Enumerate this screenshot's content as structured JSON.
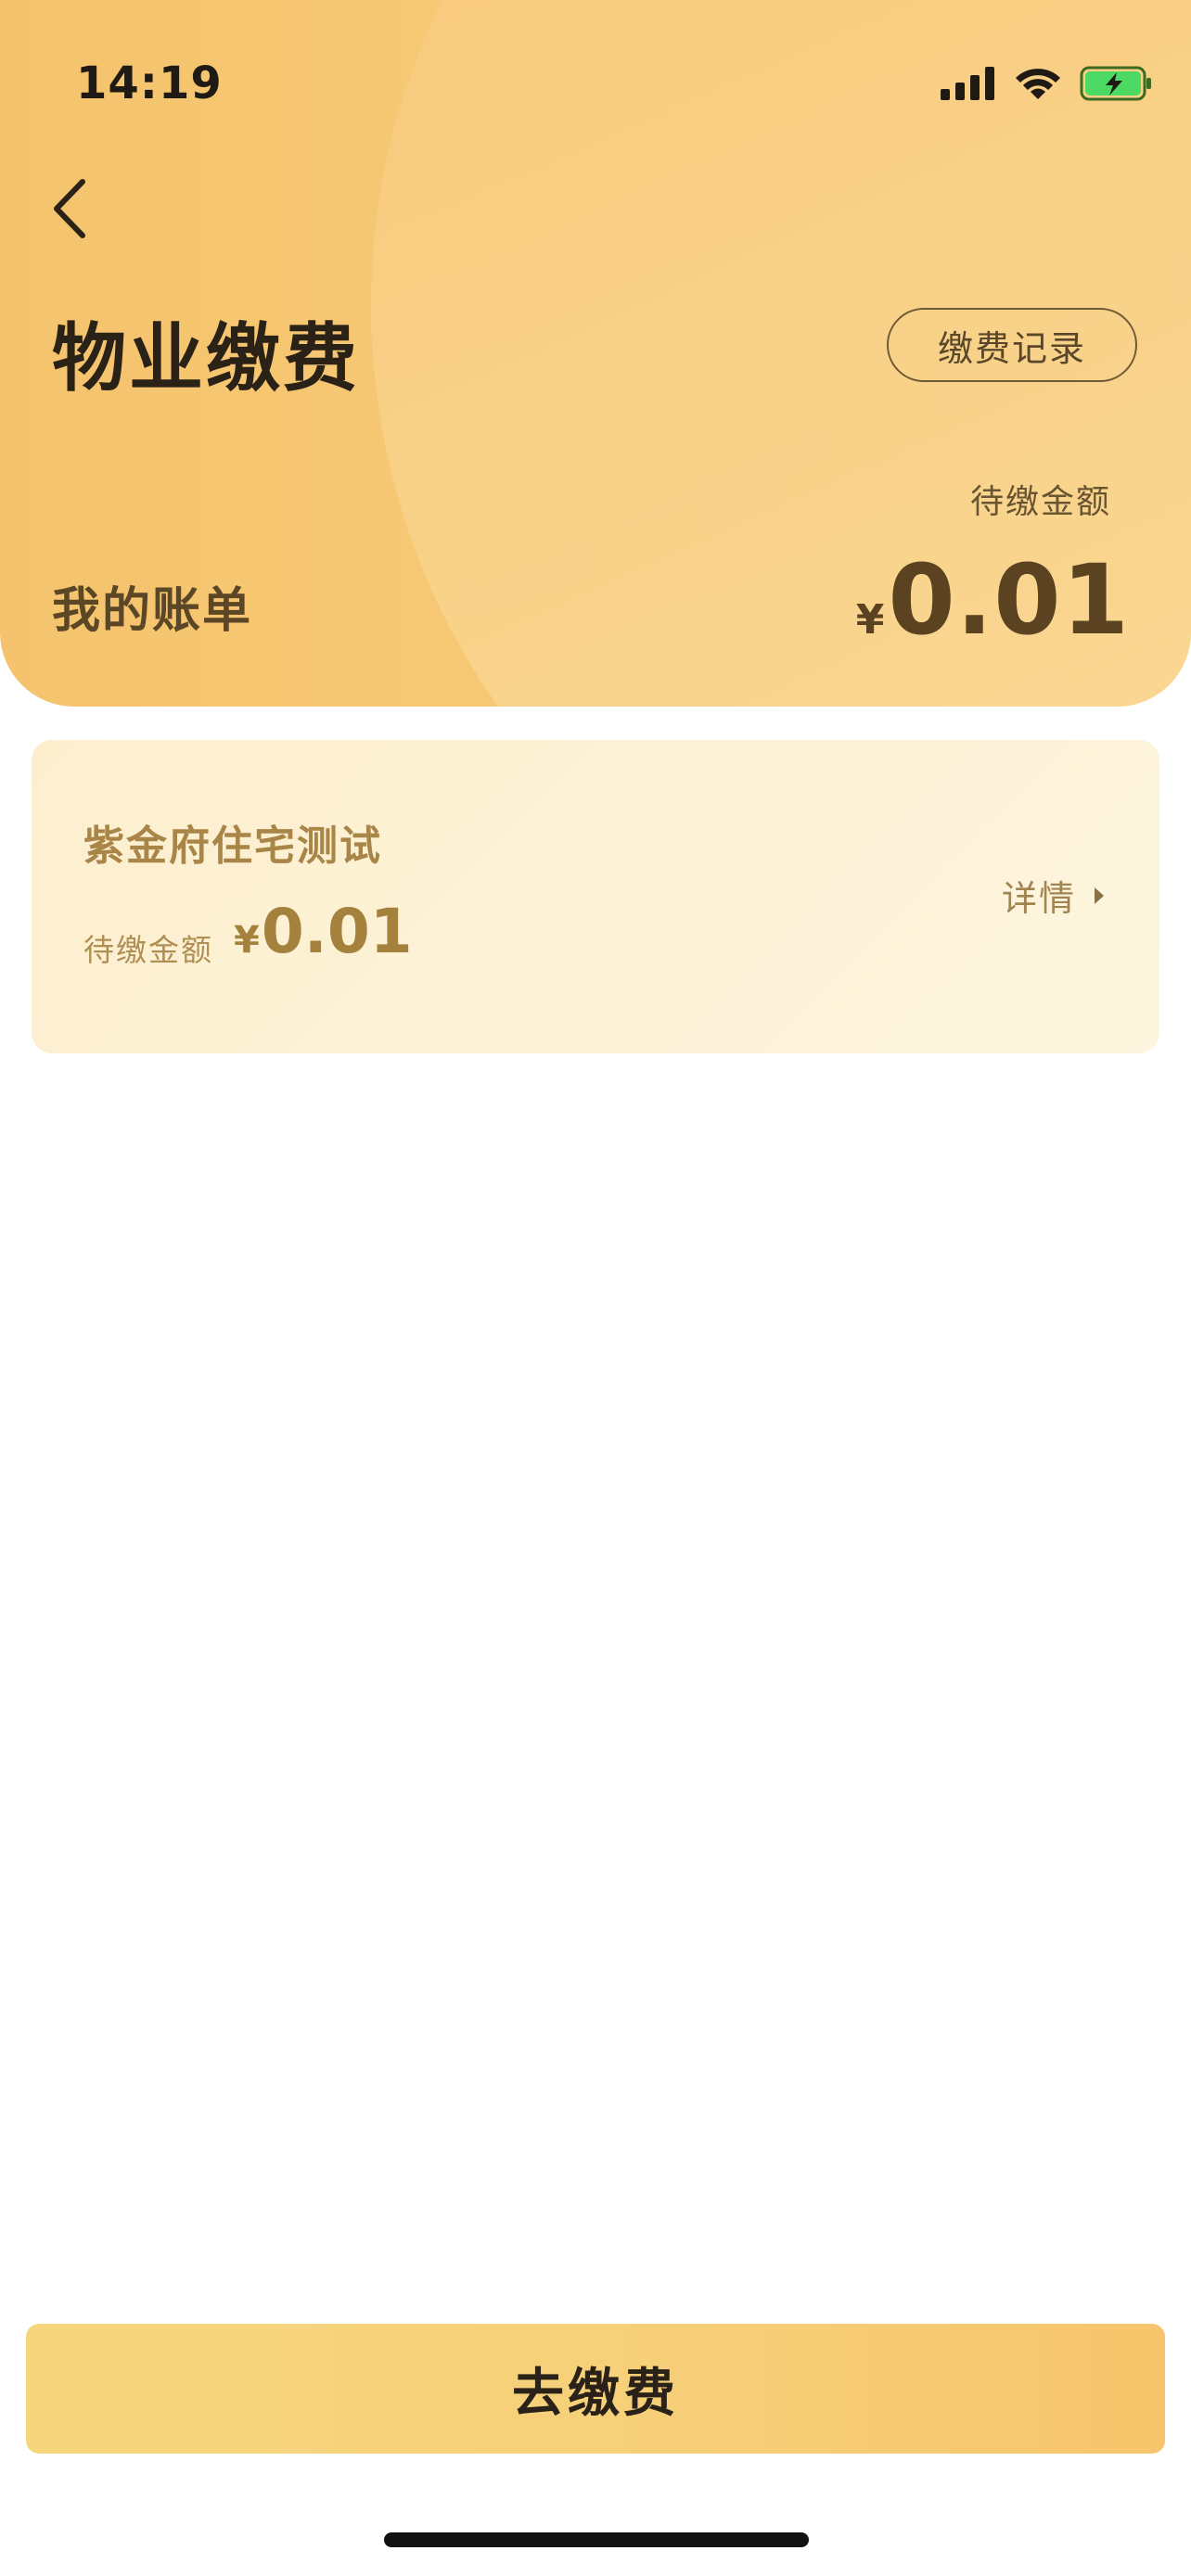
{
  "status_bar": {
    "time": "14:19",
    "icons": [
      "signal-icon",
      "wifi-icon",
      "battery-charging-icon"
    ],
    "battery_color": "#4cd964"
  },
  "header": {
    "back_icon": "chevron-left-icon",
    "title": "物业缴费",
    "record_button": "缴费记录",
    "pending_label": "待缴金额",
    "my_bill_label": "我的账单",
    "total_currency": "¥",
    "total_amount": "0.01"
  },
  "bills": [
    {
      "name": "紫金府住宅测试",
      "pending_label": "待缴金额",
      "currency": "¥",
      "amount": "0.01",
      "detail_label": "详情",
      "detail_icon": "caret-right-icon"
    }
  ],
  "footer": {
    "pay_button": "去缴费"
  },
  "colors": {
    "header_start": "#f5c36d",
    "header_end": "#f9d58e",
    "card_bg": "#fdf2d7",
    "pay_button": "#f6d67d",
    "accent_text": "#a5813e"
  }
}
